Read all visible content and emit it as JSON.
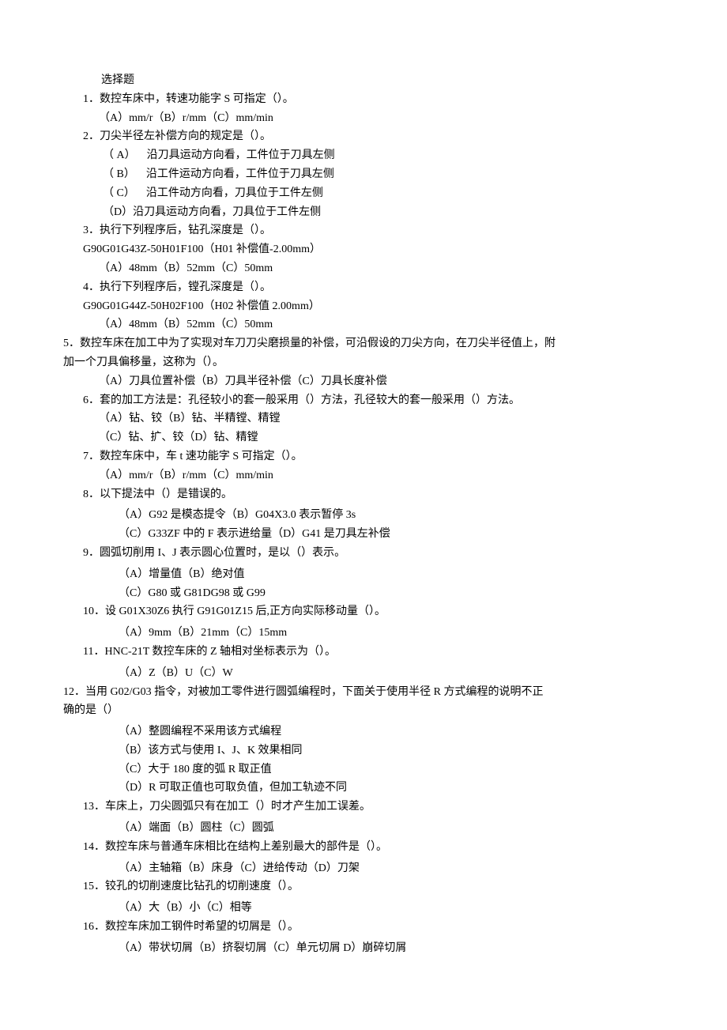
{
  "header": "选择题",
  "questions": [
    {
      "num": "1",
      "stem_lines": [
        "数控车床中，转速功能字 S 可指定（）。"
      ],
      "option_lines": [
        "（A）mm/r（B）r/mm（C）mm/min"
      ],
      "layout": "std"
    },
    {
      "num": "2",
      "stem_lines": [
        "刀尖半径左补偿方向的规定是（）。"
      ],
      "option_lines": [
        "（ A） 沿刀具运动方向看，工件位于刀具左侧",
        "（ B） 沿工件运动方向看，工件位于刀具左侧",
        "（ C） 沿工件动方向看，刀具位于工件左侧",
        "（D）沿刀具运动方向看，刀具位于工件左侧"
      ],
      "layout": "multi"
    },
    {
      "num": "3",
      "stem_lines": [
        "执行下列程序后，钻孔深度是（）。",
        "G90G01G43Z-50H01F100（H01 补偿值-2.00mm）"
      ],
      "option_lines": [
        "（A）48mm（B）52mm（C）50mm"
      ],
      "layout": "std"
    },
    {
      "num": "4",
      "stem_lines": [
        "执行下列程序后，镗孔深度是（）。",
        "G90G01G44Z-50H02F100（H02 补偿值 2.00mm）"
      ],
      "option_lines": [
        "（A）48mm（B）52mm（C）50mm"
      ],
      "layout": "std"
    },
    {
      "num": "5",
      "stem_lines": [
        "数控车床在加工中为了实现对车刀刀尖磨损量的补偿，可沿假设的刀尖方向，在刀尖半径值上，附",
        "加一个刀具偏移量，这称为（）。"
      ],
      "option_lines": [
        "（A）刀具位置补偿（B）刀具半径补偿（C）刀具长度补偿"
      ],
      "layout": "wide"
    },
    {
      "num": "6",
      "stem_lines": [
        "套的加工方法是：孔径较小的套一般采用（）方法，孔径较大的套一般采用（）方法。"
      ],
      "option_lines": [
        "（A）钻、铰（B）钻、半精镗、精镗",
        "（C）钻、扩、铰（D）钻、精镗"
      ],
      "layout": "std"
    },
    {
      "num": "7",
      "stem_lines": [
        "数控车床中，车 t 速功能字 S 可指定（）。"
      ],
      "option_lines": [
        "（A）mm/r（B）r/mm（C）mm/min"
      ],
      "layout": "std"
    },
    {
      "num": "8",
      "stem_lines": [
        "以下提法中（）是错误的。"
      ],
      "option_lines": [
        "（A）G92 是模态提令（B）G04X3.0 表示暂停 3s",
        "（C）G33ZF 中的 F 表示进给量（D）G41 是刀具左补偿"
      ],
      "layout": "spaced"
    },
    {
      "num": "9",
      "stem_lines": [
        "圆弧切削用 I、J 表示圆心位置时，是以（）表示。"
      ],
      "option_lines": [
        "（A）增量值（B）绝对值",
        "（C）G80 或 G81DG98 或 G99"
      ],
      "layout": "spaced"
    },
    {
      "num": "10",
      "stem_lines": [
        "设 G01X30Z6 执行 G91G01Z15 后,正方向实际移动量（）。"
      ],
      "option_lines": [
        "（A）9mm（B）21mm（C）15mm"
      ],
      "layout": "spaced"
    },
    {
      "num": "11",
      "stem_lines": [
        "HNC-21T 数控车床的 Z 轴相对坐标表示为（）。"
      ],
      "option_lines": [
        "（A）Z（B）U（C）W"
      ],
      "layout": "spaced"
    },
    {
      "num": "12",
      "stem_lines": [
        "当用 G02/G03 指令，对被加工零件进行圆弧编程时，下面关于使用半径 R 方式编程的说明不正",
        "确的是（）"
      ],
      "option_lines": [
        "（A）整圆编程不采用该方式编程",
        "（B）该方式与使用 I、J、K 效果相同",
        "（C）大于 180 度的弧 R 取正值",
        "（D）R 可取正值也可取负值，但加工轨迹不同"
      ],
      "layout": "wide-spaced"
    },
    {
      "num": "13",
      "stem_lines": [
        "车床上，刀尖圆弧只有在加工（）时才产生加工误差。"
      ],
      "option_lines": [
        "（A）端面（B）圆柱（C）圆弧"
      ],
      "layout": "spaced"
    },
    {
      "num": "14",
      "stem_lines": [
        "数控车床与普通车床相比在结构上差别最大的部件是（）。"
      ],
      "option_lines": [
        "（A）主轴箱（B）床身（C）进给传动（D）刀架"
      ],
      "layout": "spaced"
    },
    {
      "num": "15",
      "stem_lines": [
        "铰孔的切削速度比钻孔的切削速度（）。"
      ],
      "option_lines": [
        "（A）大（B）小（C）相等"
      ],
      "layout": "spaced"
    },
    {
      "num": "16",
      "stem_lines": [
        "数控车床加工钢件时希望的切屑是（）。"
      ],
      "option_lines": [
        "（A）带状切屑（B）挤裂切屑（C）单元切屑 D）崩碎切屑"
      ],
      "layout": "spaced"
    }
  ]
}
